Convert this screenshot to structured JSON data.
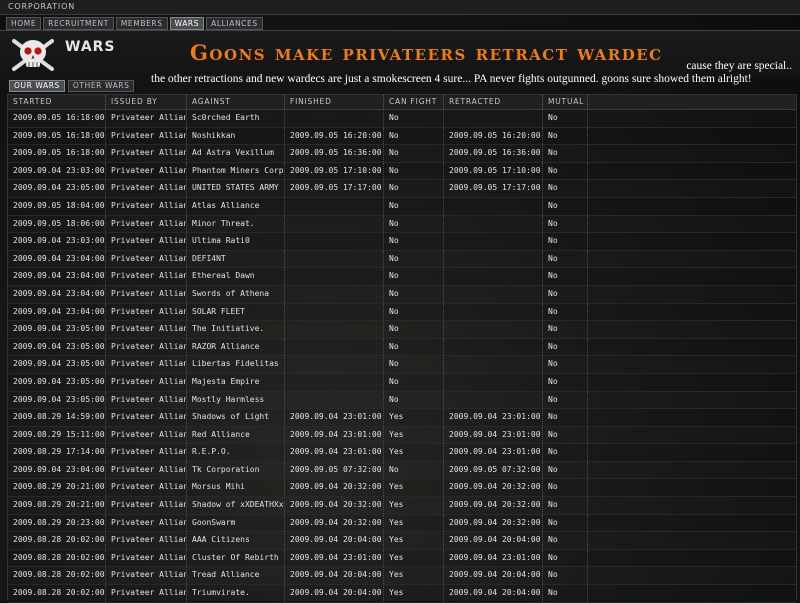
{
  "window": {
    "title": "CORPORATION"
  },
  "nav_tabs": [
    "HOME",
    "RECRUITMENT",
    "MEMBERS",
    "WARS",
    "ALLIANCES"
  ],
  "active_nav": 3,
  "header": {
    "section_title": "WARS",
    "banner": "Goons make privateers retract wardec",
    "note_line1": "cause they are special..",
    "note_line2": "the other retractions and new wardecs are just a smokescreen 4 sure... PA never fights outgunned. goons sure showed them alright!"
  },
  "sub_tabs": [
    "OUR WARS",
    "OTHER WARS"
  ],
  "active_sub": 0,
  "columns": [
    "STARTED",
    "ISSUED BY",
    "AGAINST",
    "FINISHED",
    "CAN FIGHT",
    "RETRACTED",
    "MUTUAL"
  ],
  "rows": [
    [
      "2009.09.05 16:18:00",
      "Privateer Alliance",
      "Sc0rched Earth",
      "",
      "No",
      "",
      "No"
    ],
    [
      "2009.09.05 16:18:00",
      "Privateer Alliance",
      "Noshikkan",
      "2009.09.05 16:20:00",
      "No",
      "2009.09.05 16:20:00",
      "No"
    ],
    [
      "2009.09.05 16:18:00",
      "Privateer Alliance",
      "Ad Astra Vexillum",
      "2009.09.05 16:36:00",
      "No",
      "2009.09.05 16:36:00",
      "No"
    ],
    [
      "2009.09.04 23:03:00",
      "Privateer Alliance",
      "Phantom Miners Corp",
      "2009.09.05 17:10:00",
      "No",
      "2009.09.05 17:10:00",
      "No"
    ],
    [
      "2009.09.04 23:05:00",
      "Privateer Alliance",
      "UNITED STATES ARMY",
      "2009.09.05 17:17:00",
      "No",
      "2009.09.05 17:17:00",
      "No"
    ],
    [
      "2009.09.05 18:04:00",
      "Privateer Alliance",
      "Atlas Alliance",
      "",
      "No",
      "",
      "No"
    ],
    [
      "2009.09.05 18:06:00",
      "Privateer Alliance",
      "Minor Threat.",
      "",
      "No",
      "",
      "No"
    ],
    [
      "2009.09.04 23:03:00",
      "Privateer Alliance",
      "Ultima Rati0",
      "",
      "No",
      "",
      "No"
    ],
    [
      "2009.09.04 23:04:00",
      "Privateer Alliance",
      "DEFI4NT",
      "",
      "No",
      "",
      "No"
    ],
    [
      "2009.09.04 23:04:00",
      "Privateer Alliance",
      "Ethereal Dawn",
      "",
      "No",
      "",
      "No"
    ],
    [
      "2009.09.04 23:04:00",
      "Privateer Alliance",
      "Swords of Athena",
      "",
      "No",
      "",
      "No"
    ],
    [
      "2009.09.04 23:04:00",
      "Privateer Alliance",
      "SOLAR FLEET",
      "",
      "No",
      "",
      "No"
    ],
    [
      "2009.09.04 23:05:00",
      "Privateer Alliance",
      "The Initiative.",
      "",
      "No",
      "",
      "No"
    ],
    [
      "2009.09.04 23:05:00",
      "Privateer Alliance",
      "RAZOR Alliance",
      "",
      "No",
      "",
      "No"
    ],
    [
      "2009.09.04 23:05:00",
      "Privateer Alliance",
      "Libertas Fidelitas",
      "",
      "No",
      "",
      "No"
    ],
    [
      "2009.09.04 23:05:00",
      "Privateer Alliance",
      "Majesta Empire",
      "",
      "No",
      "",
      "No"
    ],
    [
      "2009.09.04 23:05:00",
      "Privateer Alliance",
      "Mostly Harmless",
      "",
      "No",
      "",
      "No"
    ],
    [
      "2009.08.29 14:59:00",
      "Privateer Alliance",
      "Shadows of Light",
      "2009.09.04 23:01:00",
      "Yes",
      "2009.09.04 23:01:00",
      "No"
    ],
    [
      "2009.08.29 15:11:00",
      "Privateer Alliance",
      "Red Alliance",
      "2009.09.04 23:01:00",
      "Yes",
      "2009.09.04 23:01:00",
      "No"
    ],
    [
      "2009.08.29 17:14:00",
      "Privateer Alliance",
      "R.E.P.O.",
      "2009.09.04 23:01:00",
      "Yes",
      "2009.09.04 23:01:00",
      "No"
    ],
    [
      "2009.09.04 23:04:00",
      "Privateer Alliance",
      "Tk Corporation",
      "2009.09.05 07:32:00",
      "No",
      "2009.09.05 07:32:00",
      "No"
    ],
    [
      "2009.08.29 20:21:00",
      "Privateer Alliance",
      "Morsus Mihi",
      "2009.09.04 20:32:00",
      "Yes",
      "2009.09.04 20:32:00",
      "No"
    ],
    [
      "2009.08.29 20:21:00",
      "Privateer Alliance",
      "Shadow of xXDEATHXx",
      "2009.09.04 20:32:00",
      "Yes",
      "2009.09.04 20:32:00",
      "No"
    ],
    [
      "2009.08.29 20:23:00",
      "Privateer Alliance",
      "GoonSwarm",
      "2009.09.04 20:32:00",
      "Yes",
      "2009.09.04 20:32:00",
      "No"
    ],
    [
      "2009.08.28 20:02:00",
      "Privateer Alliance",
      "AAA Citizens",
      "2009.09.04 20:04:00",
      "Yes",
      "2009.09.04 20:04:00",
      "No"
    ],
    [
      "2009.08.28 20:02:00",
      "Privateer Alliance",
      "Cluster Of Rebirth",
      "2009.09.04 23:01:00",
      "Yes",
      "2009.09.04 23:01:00",
      "No"
    ],
    [
      "2009.08.28 20:02:00",
      "Privateer Alliance",
      "Tread Alliance",
      "2009.09.04 20:04:00",
      "Yes",
      "2009.09.04 20:04:00",
      "No"
    ],
    [
      "2009.08.28 20:02:00",
      "Privateer Alliance",
      "Triumvirate.",
      "2009.09.04 20:04:00",
      "Yes",
      "2009.09.04 20:04:00",
      "No"
    ]
  ]
}
